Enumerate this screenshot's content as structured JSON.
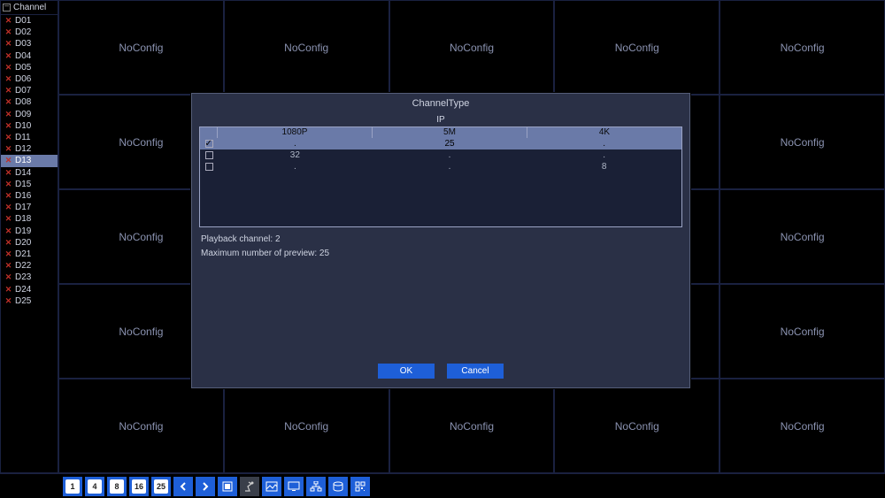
{
  "sidebar": {
    "title": "Channel",
    "items": [
      {
        "label": "D01",
        "selected": false
      },
      {
        "label": "D02",
        "selected": false
      },
      {
        "label": "D03",
        "selected": false
      },
      {
        "label": "D04",
        "selected": false
      },
      {
        "label": "D05",
        "selected": false
      },
      {
        "label": "D06",
        "selected": false
      },
      {
        "label": "D07",
        "selected": false
      },
      {
        "label": "D08",
        "selected": false
      },
      {
        "label": "D09",
        "selected": false
      },
      {
        "label": "D10",
        "selected": false
      },
      {
        "label": "D11",
        "selected": false
      },
      {
        "label": "D12",
        "selected": false
      },
      {
        "label": "D13",
        "selected": true
      },
      {
        "label": "D14",
        "selected": false
      },
      {
        "label": "D15",
        "selected": false
      },
      {
        "label": "D16",
        "selected": false
      },
      {
        "label": "D17",
        "selected": false
      },
      {
        "label": "D18",
        "selected": false
      },
      {
        "label": "D19",
        "selected": false
      },
      {
        "label": "D20",
        "selected": false
      },
      {
        "label": "D21",
        "selected": false
      },
      {
        "label": "D22",
        "selected": false
      },
      {
        "label": "D23",
        "selected": false
      },
      {
        "label": "D24",
        "selected": false
      },
      {
        "label": "D25",
        "selected": false
      }
    ]
  },
  "grid": {
    "cell_label": "NoConfig",
    "rows": 5,
    "cols": 5
  },
  "toolbar": {
    "view_buttons": [
      "1",
      "4",
      "8",
      "16",
      "25"
    ],
    "icons": [
      "prev",
      "next",
      "fullscreen",
      "ptz",
      "image",
      "monitor",
      "network",
      "disk",
      "qr"
    ]
  },
  "dialog": {
    "title": "ChannelType",
    "header_label": "IP",
    "columns": [
      "",
      "1080P",
      "5M",
      "4K"
    ],
    "rows": [
      {
        "checked": true,
        "c1080p": ".",
        "c5m": "25",
        "c4k": ".",
        "selected": true
      },
      {
        "checked": false,
        "c1080p": "32",
        "c5m": ".",
        "c4k": ".",
        "selected": false
      },
      {
        "checked": false,
        "c1080p": ".",
        "c5m": ".",
        "c4k": "8",
        "selected": false
      }
    ],
    "playback_label": "Playback channel: 2",
    "preview_label": "Maximum number of preview: 25",
    "ok_label": "OK",
    "cancel_label": "Cancel"
  }
}
